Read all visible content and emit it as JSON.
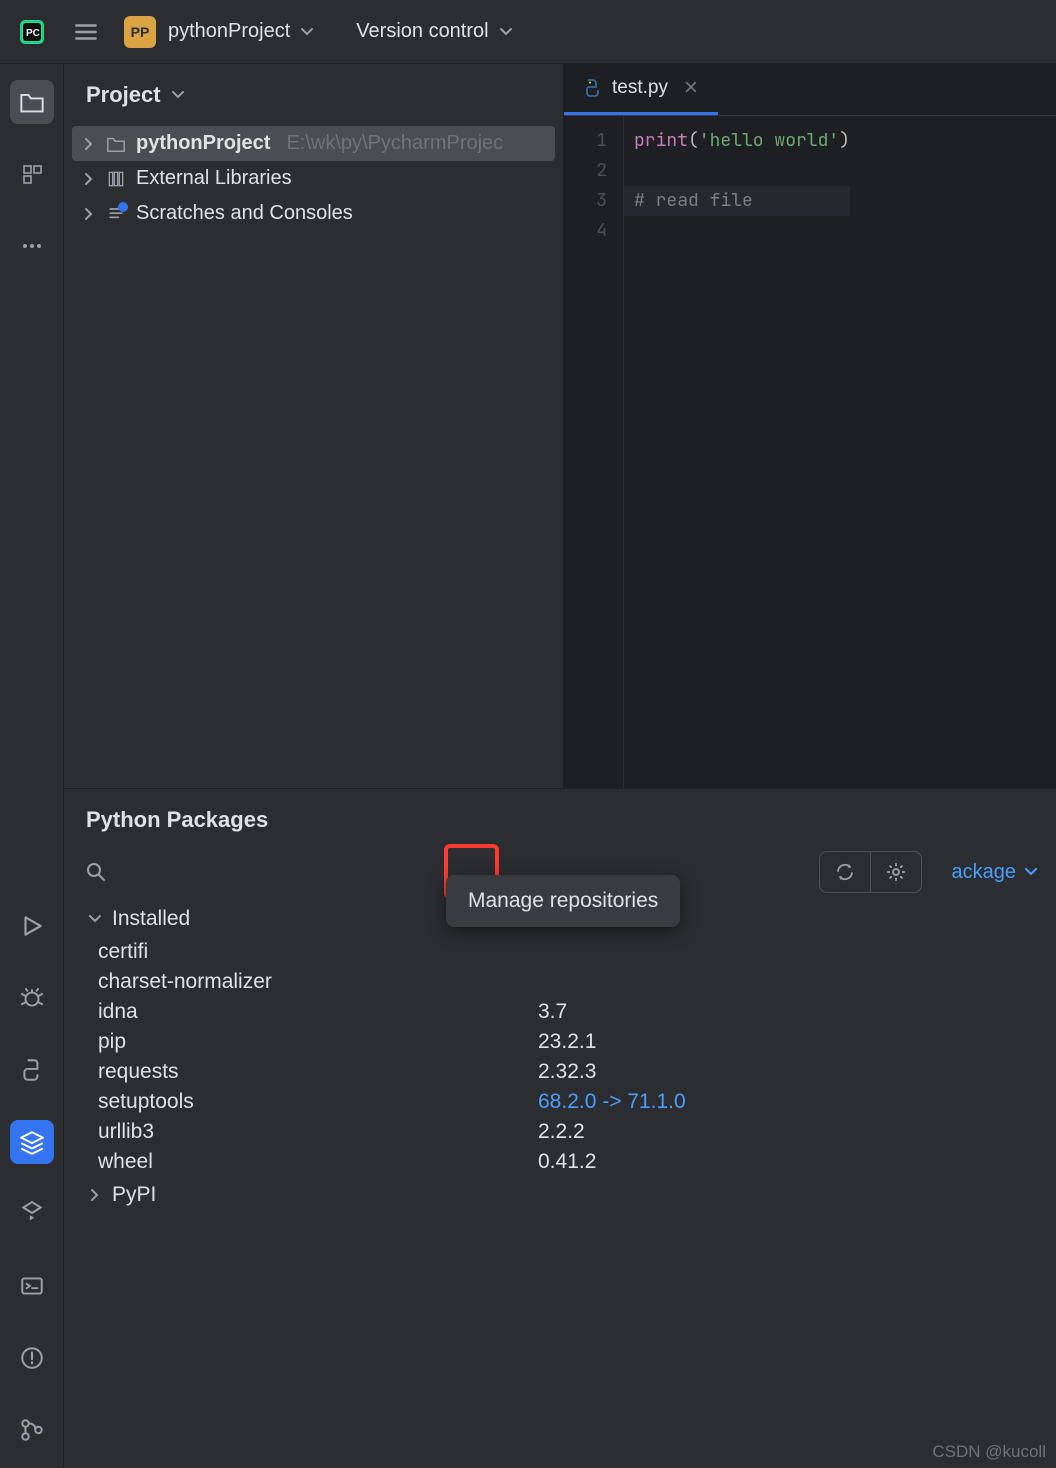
{
  "topbar": {
    "project_badge": "PP",
    "project_name": "pythonProject",
    "version_control": "Version control"
  },
  "project_panel": {
    "title": "Project",
    "items": [
      {
        "label": "pythonProject",
        "path": "E:\\wk\\py\\PycharmProjec",
        "icon": "folder",
        "selected": true
      },
      {
        "label": "External Libraries",
        "icon": "library"
      },
      {
        "label": "Scratches and Consoles",
        "icon": "scratch"
      }
    ]
  },
  "editor": {
    "tab_name": "test.py",
    "lines": [
      {
        "num": "1",
        "content": [
          [
            "fn",
            "print"
          ],
          [
            "punct",
            "("
          ],
          [
            "str",
            "'hello world'"
          ],
          [
            "punct",
            ")"
          ]
        ]
      },
      {
        "num": "2",
        "content": []
      },
      {
        "num": "3",
        "content": [
          [
            "comment",
            "# read file"
          ]
        ],
        "highlight": true
      },
      {
        "num": "4",
        "content": []
      }
    ]
  },
  "packages": {
    "title": "Python Packages",
    "add_label": "ackage",
    "tooltip": "Manage repositories",
    "section_installed": "Installed",
    "section_pypi": "PyPI",
    "installed": [
      {
        "name": "certifi",
        "version": ""
      },
      {
        "name": "charset-normalizer",
        "version": ""
      },
      {
        "name": "idna",
        "version": "3.7"
      },
      {
        "name": "pip",
        "version": "23.2.1"
      },
      {
        "name": "requests",
        "version": "2.32.3"
      },
      {
        "name": "setuptools",
        "version": "68.2.0 -> 71.1.0",
        "update": true
      },
      {
        "name": "urllib3",
        "version": "2.2.2"
      },
      {
        "name": "wheel",
        "version": "0.41.2"
      }
    ]
  },
  "watermark": "CSDN @kucoll"
}
